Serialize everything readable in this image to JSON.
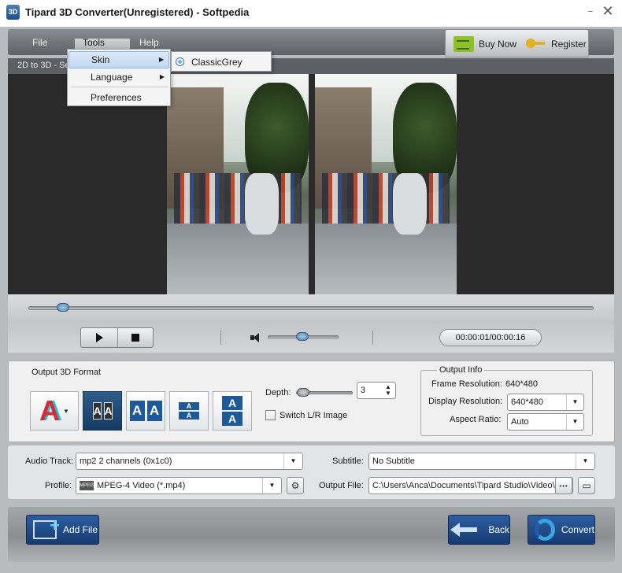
{
  "window": {
    "title": "Tipard 3D Converter(Unregistered) - Softpedia",
    "icon_text": "3D",
    "minimize_glyph": "−",
    "close_glyph": "✕"
  },
  "menubar": {
    "file": "File",
    "tools": "Tools",
    "help": "Help",
    "buy_now": "Buy Now",
    "register": "Register"
  },
  "tools_menu": {
    "skin": "Skin",
    "language": "Language",
    "preferences": "Preferences",
    "submenu_arrow": "▶"
  },
  "skin_menu": {
    "selected": "ClassicGrey"
  },
  "mode": {
    "label": "2D to 3D - Se"
  },
  "player": {
    "time": "00:00:01/00:00:16",
    "seek_progress": 0.05,
    "volume_level": 0.5
  },
  "output_format": {
    "title": "Output 3D Format",
    "anaglyph_letter": "A",
    "dropdown_arrow": "▼",
    "sbs_half_letters": [
      "A",
      "A"
    ],
    "sbs_full_letters": [
      "A",
      "A"
    ],
    "tb_half_letters": [
      "A",
      "A"
    ],
    "tb_full_letters": [
      "A",
      "A"
    ],
    "selected": "side-by-side-half"
  },
  "depth": {
    "label": "Depth:",
    "value": "3",
    "spin_up": "▲",
    "spin_down": "▼"
  },
  "switch_lr": {
    "label": "Switch L/R Image",
    "checked": false
  },
  "output_info": {
    "title": "Output Info",
    "frame_resolution_label": "Frame Resolution:",
    "frame_resolution_value": "640*480",
    "display_resolution_label": "Display Resolution:",
    "display_resolution_value": "640*480",
    "aspect_ratio_label": "Aspect Ratio:",
    "aspect_ratio_value": "Auto",
    "arrow": "▼"
  },
  "settings": {
    "audio_track_label": "Audio Track:",
    "audio_track_value": "mp2 2 channels (0x1c0)",
    "subtitle_label": "Subtitle:",
    "subtitle_value": "No Subtitle",
    "profile_label": "Profile:",
    "profile_badge": "MPEG",
    "profile_value": "MPEG-4 Video (*.mp4)",
    "output_file_label": "Output File:",
    "output_file_value": "C:\\Users\\Anca\\Documents\\Tipard Studio\\Video\\3",
    "browse_glyph": "•••",
    "arrow": "▼"
  },
  "actions": {
    "add_file": "Add File",
    "back": "Back",
    "convert": "Convert"
  },
  "colors": {
    "accent_blue": "#1f4f86",
    "frame_grey": "#b9bcbf",
    "panel_light": "#f0f0f0"
  }
}
